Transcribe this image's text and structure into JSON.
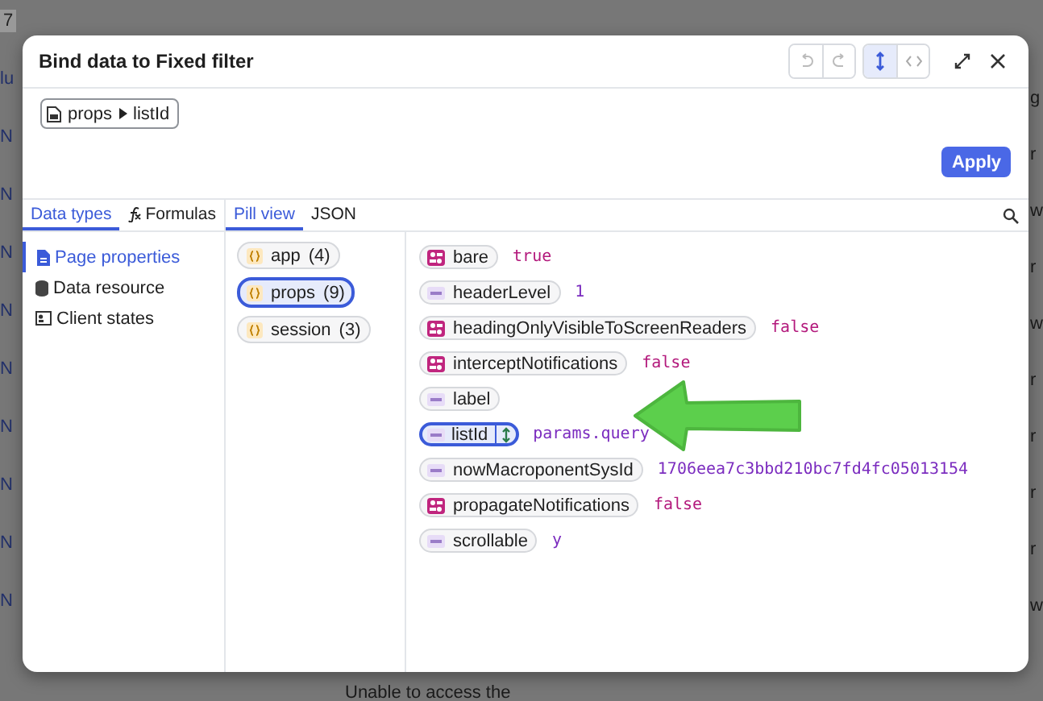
{
  "background": {
    "left_edge": [
      "7",
      "lu",
      "N",
      "N",
      "N",
      "N",
      "N",
      "N",
      "N",
      "N",
      "N"
    ],
    "right_edge": [
      "g",
      "r",
      "w",
      "r",
      "w",
      "r",
      "r",
      "r",
      "r",
      "w"
    ],
    "bottom_text": "Unable to access the"
  },
  "dialog": {
    "title": "Bind data to Fixed filter",
    "path": {
      "parts": [
        "props",
        "listId"
      ]
    },
    "apply_button": "Apply",
    "source_tabs": [
      {
        "label": "Data types",
        "selected": true
      },
      {
        "label": "Formulas",
        "selected": false
      }
    ],
    "view_tabs": [
      {
        "label": "Pill view",
        "selected": true
      },
      {
        "label": "JSON",
        "selected": false
      }
    ],
    "sources": [
      {
        "label": "Page properties",
        "kind": "page",
        "selected": true
      },
      {
        "label": "Data resource",
        "kind": "resource",
        "selected": false
      },
      {
        "label": "Client states",
        "kind": "state",
        "selected": false
      }
    ],
    "groups": [
      {
        "name": "app",
        "count": "(4)",
        "selected": false
      },
      {
        "name": "props",
        "count": "(9)",
        "selected": true
      },
      {
        "name": "session",
        "count": "(3)",
        "selected": false
      }
    ],
    "properties": [
      {
        "name": "bare",
        "kind": "boolean",
        "value": "true",
        "selected": false
      },
      {
        "name": "headerLevel",
        "kind": "string",
        "value": "1",
        "selected": false
      },
      {
        "name": "headingOnlyVisibleToScreenReaders",
        "kind": "boolean",
        "value": "false",
        "selected": false
      },
      {
        "name": "interceptNotifications",
        "kind": "boolean",
        "value": "false",
        "selected": false
      },
      {
        "name": "label",
        "kind": "string",
        "selected": false
      },
      {
        "name": "listId",
        "kind": "string",
        "value": "params.query",
        "selected": true
      },
      {
        "name": "nowMacroponentSysId",
        "kind": "string",
        "value": "1706eea7c3bbd210bc7fd4fc05013154",
        "selected": false
      },
      {
        "name": "propagateNotifications",
        "kind": "boolean",
        "value": "false",
        "selected": false
      },
      {
        "name": "scrollable",
        "kind": "string",
        "value": "y",
        "selected": false
      }
    ]
  }
}
